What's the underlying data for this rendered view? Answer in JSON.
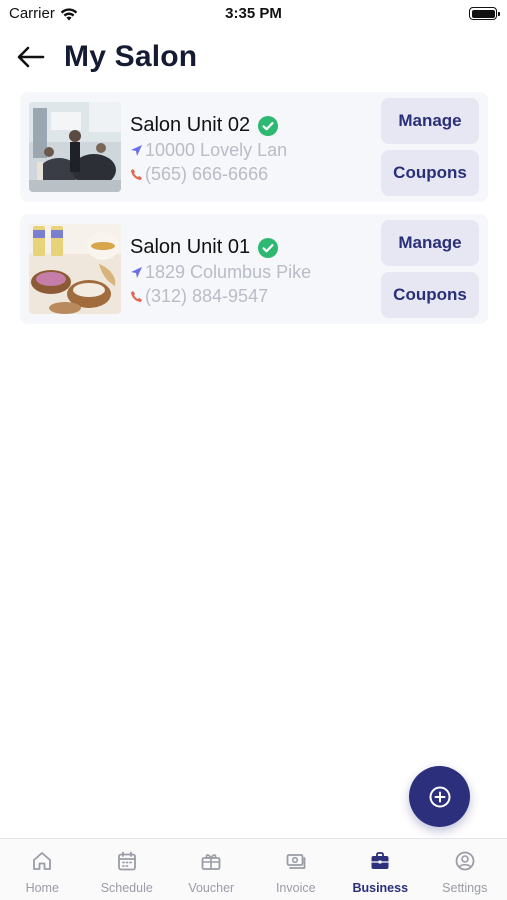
{
  "status_bar": {
    "carrier": "Carrier",
    "time": "3:35 PM"
  },
  "header": {
    "title": "My Salon"
  },
  "colors": {
    "accent": "#2b2f7c",
    "verified": "#2eb872",
    "location": "#6a6de8",
    "phone": "#e2664f"
  },
  "salons": [
    {
      "name": "Salon Unit 02",
      "address": "10000 Lovely Lan",
      "phone": "(565) 666-6666",
      "manage_label": "Manage",
      "coupons_label": "Coupons"
    },
    {
      "name": "Salon Unit 01",
      "address": "1829 Columbus Pike",
      "phone": "(312) 884-9547",
      "manage_label": "Manage",
      "coupons_label": "Coupons"
    }
  ],
  "fab": {
    "icon": "plus-circle-icon"
  },
  "tabs": [
    {
      "label": "Home",
      "icon": "home-icon",
      "active": false
    },
    {
      "label": "Schedule",
      "icon": "calendar-icon",
      "active": false
    },
    {
      "label": "Voucher",
      "icon": "gift-card-icon",
      "active": false
    },
    {
      "label": "Invoice",
      "icon": "money-icon",
      "active": false
    },
    {
      "label": "Business",
      "icon": "briefcase-icon",
      "active": true
    },
    {
      "label": "Settings",
      "icon": "user-circle-icon",
      "active": false
    }
  ]
}
